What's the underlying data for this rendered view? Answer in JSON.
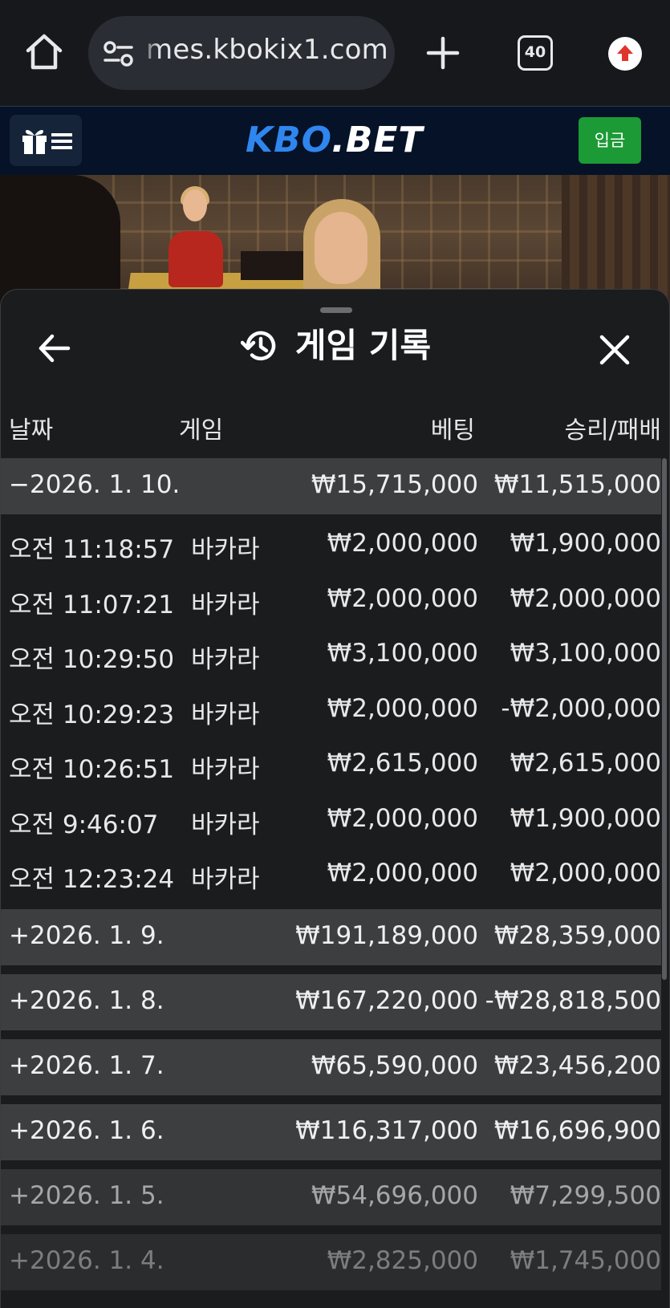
{
  "browser": {
    "url": "mes.kbokix1.com",
    "tab_count": "40"
  },
  "header": {
    "logo_kbo": "KBO",
    "logo_dot": ".",
    "logo_bet": "BET",
    "deposit_label": "입금"
  },
  "sheet": {
    "title": "게임 기록",
    "columns": {
      "date": "날짜",
      "game": "게임",
      "bet": "베팅",
      "win_loss": "승리/패배"
    },
    "expanded_day": {
      "date": "−2026. 1. 10.",
      "bet": "₩15,715,000",
      "win_loss": "₩11,515,000",
      "entries": [
        {
          "time": "오전 11:18:57",
          "game": "바카라",
          "bet": "₩2,000,000",
          "win_loss": "₩1,900,000"
        },
        {
          "time": "오전 11:07:21",
          "game": "바카라",
          "bet": "₩2,000,000",
          "win_loss": "₩2,000,000"
        },
        {
          "time": "오전 10:29:50",
          "game": "바카라",
          "bet": "₩3,100,000",
          "win_loss": "₩3,100,000"
        },
        {
          "time": "오전 10:29:23",
          "game": "바카라",
          "bet": "₩2,000,000",
          "win_loss": "-₩2,000,000"
        },
        {
          "time": "오전 10:26:51",
          "game": "바카라",
          "bet": "₩2,615,000",
          "win_loss": "₩2,615,000"
        },
        {
          "time": "오전 9:46:07",
          "game": "바카라",
          "bet": "₩2,000,000",
          "win_loss": "₩1,900,000"
        },
        {
          "time": "오전 12:23:24",
          "game": "바카라",
          "bet": "₩2,000,000",
          "win_loss": "₩2,000,000"
        }
      ]
    },
    "collapsed_days": [
      {
        "date": "+2026. 1. 9.",
        "bet": "₩191,189,000",
        "win_loss": "₩28,359,000"
      },
      {
        "date": "+2026. 1. 8.",
        "bet": "₩167,220,000",
        "win_loss": "-₩28,818,500"
      },
      {
        "date": "+2026. 1. 7.",
        "bet": "₩65,590,000",
        "win_loss": "₩23,456,200"
      },
      {
        "date": "+2026. 1. 6.",
        "bet": "₩116,317,000",
        "win_loss": "₩16,696,900"
      },
      {
        "date": "+2026. 1. 5.",
        "bet": "₩54,696,000",
        "win_loss": "₩7,299,500"
      },
      {
        "date": "+2026. 1. 4.",
        "bet": "₩2,825,000",
        "win_loss": "₩1,745,000"
      }
    ]
  },
  "colors": {
    "accent_blue": "#2f86ee",
    "deposit_green": "#1c9a35",
    "update_red": "#e0352b"
  },
  "icons": [
    "home-icon",
    "tune-icon",
    "plus-icon",
    "tabs-icon",
    "update-icon",
    "gift-icon",
    "menu-icon",
    "back-arrow-icon",
    "history-icon",
    "close-icon"
  ]
}
